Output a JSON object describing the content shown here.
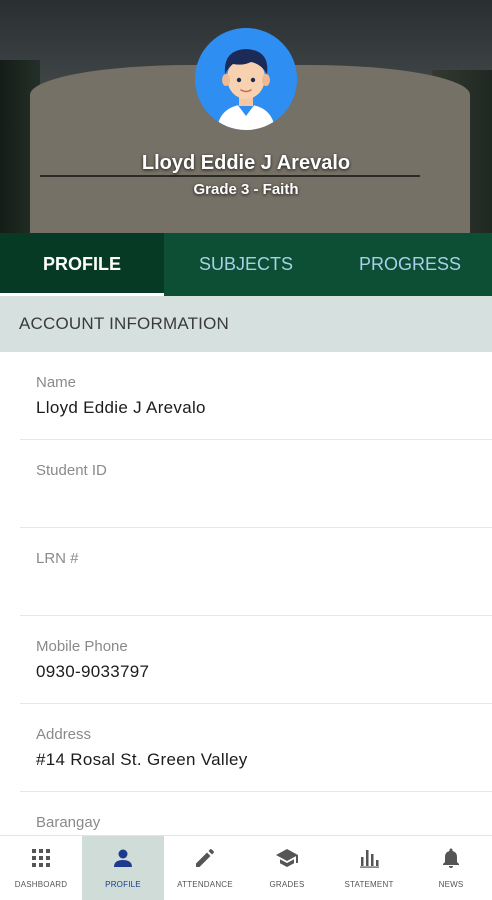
{
  "profile": {
    "name": "Lloyd Eddie  J Arevalo",
    "grade_section": "Grade 3 - Faith"
  },
  "tabs": [
    {
      "label": "PROFILE",
      "active": true
    },
    {
      "label": "SUBJECTS",
      "active": false
    },
    {
      "label": "PROGRESS",
      "active": false
    }
  ],
  "section": {
    "title": "ACCOUNT INFORMATION"
  },
  "fields": [
    {
      "label": "Name",
      "value": "Lloyd Eddie  J Arevalo"
    },
    {
      "label": "Student ID",
      "value": ""
    },
    {
      "label": "LRN #",
      "value": ""
    },
    {
      "label": "Mobile Phone",
      "value": "0930-9033797"
    },
    {
      "label": "Address",
      "value": "#14 Rosal St. Green Valley"
    },
    {
      "label": "Barangay",
      "value": ""
    }
  ],
  "bottom_nav": [
    {
      "label": "DASHBOARD",
      "icon": "grid-icon",
      "active": false
    },
    {
      "label": "PROFILE",
      "icon": "person-icon",
      "active": true
    },
    {
      "label": "ATTENDANCE",
      "icon": "pencil-icon",
      "active": false
    },
    {
      "label": "GRADES",
      "icon": "graduation-cap-icon",
      "active": false
    },
    {
      "label": "STATEMENT",
      "icon": "bar-chart-icon",
      "active": false
    },
    {
      "label": "NEWS",
      "icon": "bell-icon",
      "active": false
    }
  ],
  "colors": {
    "tab_bar": "#0c4f34",
    "tab_active": "#063a25",
    "section_bg": "#d6e1df",
    "nav_active_bg": "#cfdcd8",
    "avatar_bg": "#2f8ef2"
  }
}
